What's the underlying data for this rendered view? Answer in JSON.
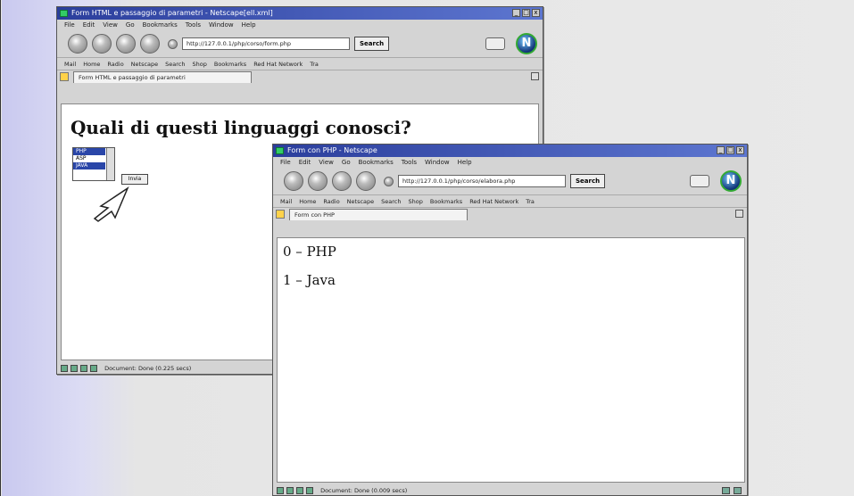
{
  "window1": {
    "title": "Form HTML e passaggio di parametri - Netscape[ell.xml]",
    "menu": [
      "File",
      "Edit",
      "View",
      "Go",
      "Bookmarks",
      "Tools",
      "Window",
      "Help"
    ],
    "url": "http://127.0.0.1/php/corso/form.php",
    "search_label": "Search",
    "personal_bar": [
      "Mail",
      "Home",
      "Radio",
      "Netscape",
      "Search",
      "Shop",
      "Bookmarks",
      "Red Hat Network",
      "Tra"
    ],
    "tab_label": "Form HTML e passaggio di parametri",
    "heading": "Quali di questi linguaggi conosci?",
    "listbox_options": [
      "PHP",
      "ASP",
      "JAVA"
    ],
    "submit_label": "Invia",
    "status": "Document: Done (0.225 secs)"
  },
  "window2": {
    "title": "Form con PHP - Netscape",
    "menu": [
      "File",
      "Edit",
      "View",
      "Go",
      "Bookmarks",
      "Tools",
      "Window",
      "Help"
    ],
    "url": "http://127.0.0.1/php/corso/elabora.php",
    "search_label": "Search",
    "personal_bar": [
      "Mail",
      "Home",
      "Radio",
      "Netscape",
      "Search",
      "Shop",
      "Bookmarks",
      "Red Hat Network",
      "Tra"
    ],
    "tab_label": "Form con PHP",
    "results": [
      "0 – PHP",
      "1 – Java"
    ],
    "status": "Document: Done (0.009 secs)"
  },
  "icons": {
    "netscape_logo": "netscape-n-icon",
    "cursor": "hand-pointer-cursor"
  }
}
